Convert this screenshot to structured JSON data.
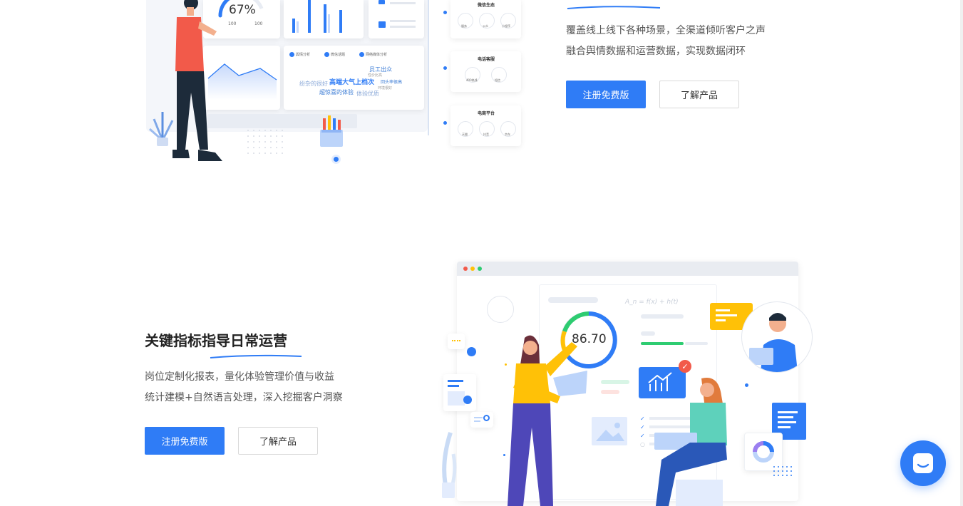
{
  "section_top": {
    "desc_line1": "覆盖线上线下各种场景，全渠道倾听客户之声",
    "desc_line2": "融合舆情数据和运营数据，实现数据闭环",
    "register_label": "注册免费版",
    "learn_label": "了解产品",
    "illustration": {
      "gauge_value": "67%",
      "gauge_min": "100",
      "gauge_max": "100",
      "channel_groups": [
        {
          "title": "微信生态",
          "items": [
            "服务",
            "公众",
            "小程序"
          ]
        },
        {
          "title": "电话客服",
          "items": [
            "400热线",
            "短信"
          ]
        },
        {
          "title": "电商平台",
          "items": [
            "天猫",
            "抖音",
            "京东"
          ]
        }
      ],
      "word_cloud": [
        "高端大气上档次",
        "员工出众",
        "超惊喜的体验",
        "性价比高",
        "纷杂的很好",
        "体验优质",
        "回头率很高",
        "环境很好"
      ],
      "tab_labels": [
        "舆情分析",
        "微信话题",
        "网络媒体分析"
      ]
    }
  },
  "section_bottom": {
    "title": "关键指标指导日常运营",
    "desc_line1": "岗位定制化报表，量化体验管理价值与收益",
    "desc_line2": "统计建模+自然语言处理，深入挖掘客户洞察",
    "register_label": "注册免费版",
    "learn_label": "了解产品",
    "illustration": {
      "score": "86.70",
      "formula": "A_n = f(x) + h(t)"
    }
  },
  "colors": {
    "primary": "#2f7cf6",
    "yellow": "#ffc107",
    "green": "#2ecc71",
    "red": "#f25a4a"
  },
  "chat_widget": {
    "icon": "chat-icon"
  }
}
